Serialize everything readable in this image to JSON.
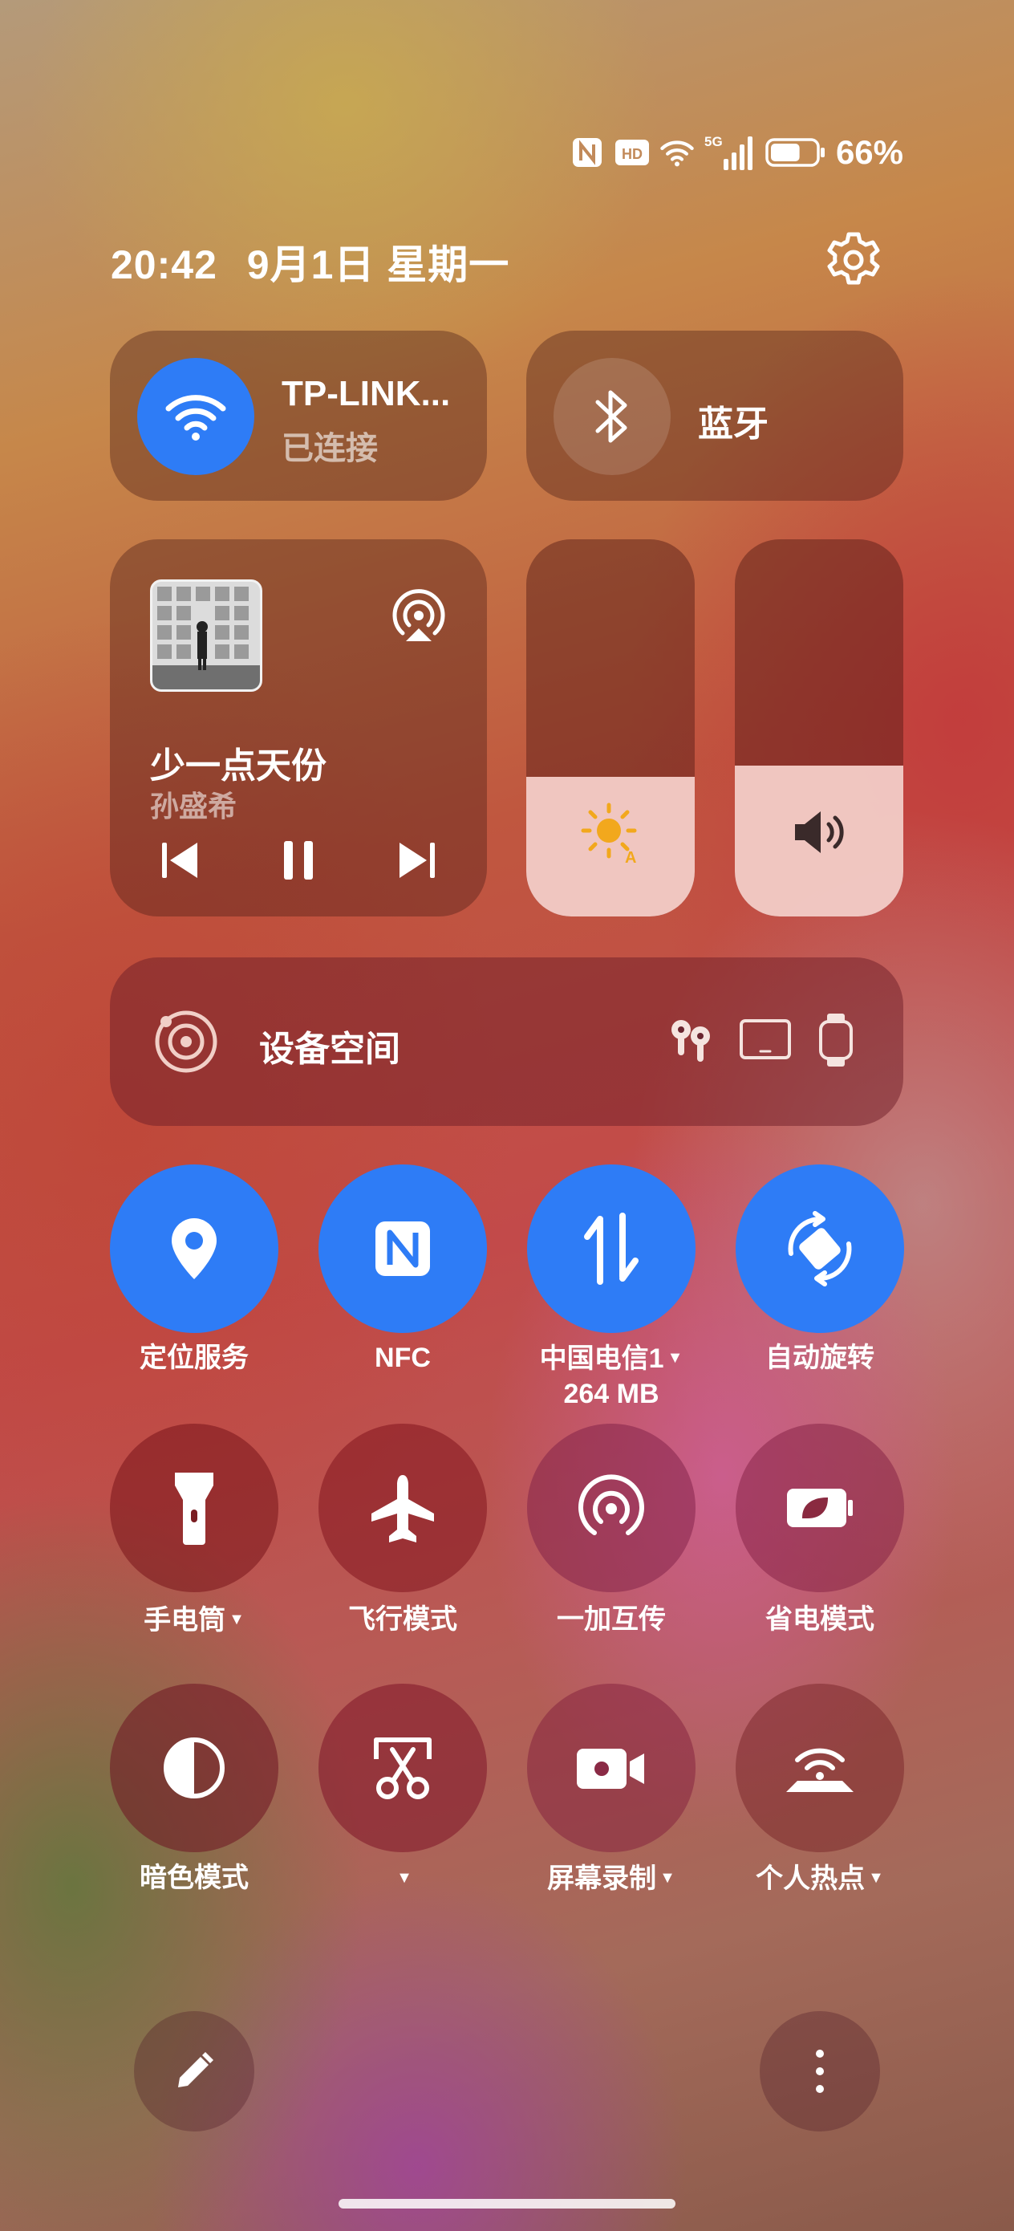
{
  "status_bar": {
    "icons": [
      "nfc-icon",
      "hd-icon",
      "wifi-icon",
      "5g-signal-icon",
      "battery-icon"
    ],
    "network": "5G",
    "battery_percent": "66%",
    "battery_level": 0.66
  },
  "header": {
    "time": "20:42",
    "date": "9月1日 星期一",
    "settings_icon": "gear-icon"
  },
  "wifi": {
    "title": "TP-LINK...",
    "status": "已连接",
    "icon": "wifi-icon",
    "active_color": "#2e7cf6"
  },
  "bluetooth": {
    "title": "蓝牙",
    "icon": "bluetooth-icon"
  },
  "media": {
    "song": "少一点天份",
    "artist": "孙盛希",
    "icons": [
      "album-art",
      "cast-icon",
      "previous-icon",
      "pause-icon",
      "next-icon"
    ]
  },
  "brightness": {
    "level": 0.37,
    "icon": "sun-auto-icon"
  },
  "volume": {
    "level": 0.4,
    "icon": "speaker-icon"
  },
  "device_space": {
    "label": "设备空间",
    "devices": [
      "earbuds-icon",
      "tablet-icon",
      "watch-icon"
    ]
  },
  "toggles": [
    {
      "label": "定位服务",
      "icon": "location-pin-icon",
      "active": true
    },
    {
      "label": "NFC",
      "icon": "nfc-icon",
      "active": true
    },
    {
      "label": "中国电信1",
      "sublabel": "264 MB",
      "icon": "mobile-data-icon",
      "active": true,
      "dropdown": true
    },
    {
      "label": "自动旋转",
      "icon": "auto-rotate-icon",
      "active": true
    },
    {
      "label": "手电筒",
      "icon": "flashlight-icon",
      "active": false,
      "dropdown": true
    },
    {
      "label": "飞行模式",
      "icon": "airplane-icon",
      "active": false
    },
    {
      "label": "一加互传",
      "icon": "share-broadcast-icon",
      "active": false
    },
    {
      "label": "省电模式",
      "icon": "battery-saver-icon",
      "active": false
    },
    {
      "label": "暗色模式",
      "icon": "dark-mode-icon",
      "active": false
    },
    {
      "label": "",
      "icon": "screenshot-scissors-icon",
      "active": false,
      "dropdown": true
    },
    {
      "label": "屏幕录制",
      "icon": "screen-record-icon",
      "active": false,
      "dropdown": true
    },
    {
      "label": "个人热点",
      "icon": "hotspot-icon",
      "active": false,
      "dropdown": true
    }
  ],
  "bottom": {
    "edit_icon": "pencil-icon",
    "more_icon": "more-vertical-icon"
  },
  "colors": {
    "accent": "#2e7cf6",
    "sun": "#f2a81d"
  }
}
